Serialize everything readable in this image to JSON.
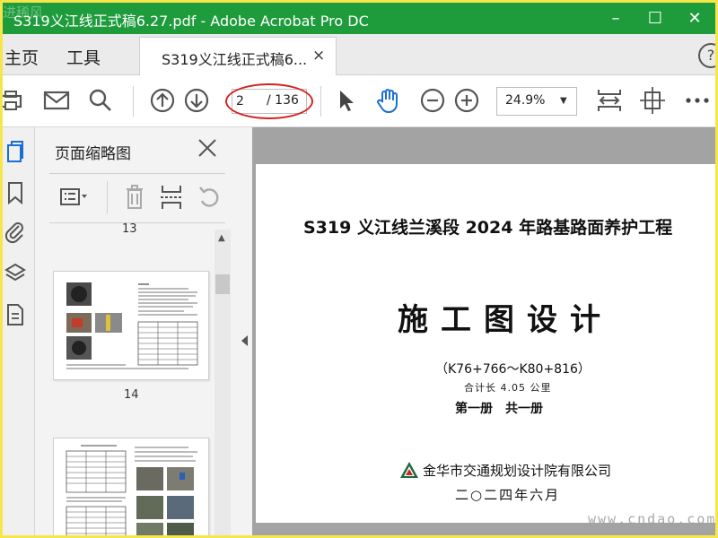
{
  "window": {
    "title": "S319义江线正式稿6.27.pdf - Adobe Acrobat Pro DC",
    "watermark_top": "进稀风",
    "colors": {
      "titlebar": "#1e9c3c",
      "frame": "#f7e64a",
      "annotation": "#d42222"
    }
  },
  "menu": {
    "home": "主页",
    "tools": "工具"
  },
  "tab": {
    "label": "S319义江线正式稿6...",
    "close": "×"
  },
  "toolbar": {
    "current_page": "2",
    "total_pages": "/ 136",
    "zoom": "24.9%",
    "icons": [
      "print-icon",
      "mail-icon",
      "search-icon",
      "page-up-icon",
      "page-down-icon",
      "select-arrow-icon",
      "hand-icon",
      "zoom-out-icon",
      "zoom-in-icon",
      "fit-page-icon",
      "rotate-page-icon",
      "more-icon"
    ]
  },
  "nav_icons": [
    "pages-icon",
    "bookmark-icon",
    "attachment-icon",
    "layers-icon",
    "content-icon"
  ],
  "thumbnails": {
    "title": "页面缩略图",
    "icons": [
      "options-icon",
      "delete-icon",
      "insert-icon",
      "undo-icon"
    ],
    "partial_label": "13",
    "page_14_label": "14"
  },
  "document": {
    "line1": "S319 义江线兰溪段 2024 年路基路面养护工程",
    "line2": "施工图设计",
    "line3": "（K76+766～K80+816）",
    "line4": "合计长 4.05 公里",
    "line5": "第一册　共一册",
    "line6": "金华市交通规划设计院有限公司",
    "line7": "二○二四年六月"
  },
  "watermark_bottom": "www.cndao.com"
}
